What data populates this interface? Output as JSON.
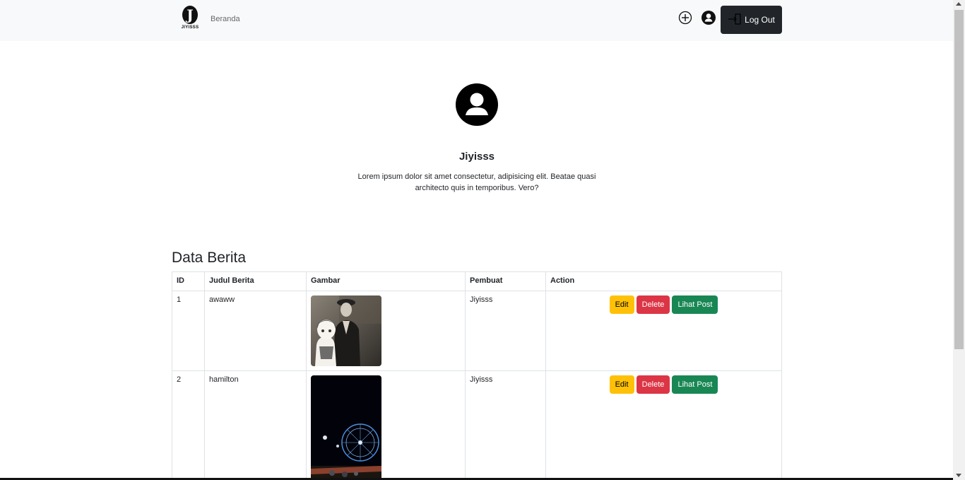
{
  "navbar": {
    "brand_letter": "J",
    "brand_text": "JIYISSS",
    "home_link": "Beranda",
    "logout_label": "Log Out",
    "icons": [
      "plus-circle-icon",
      "user-circle-icon",
      "logout-icon"
    ]
  },
  "profile": {
    "name": "Jiyisss",
    "description": "Lorem ipsum dolor sit amet consectetur, adipisicing elit. Beatae quasi architecto quis in temporibus. Vero?"
  },
  "section": {
    "title": "Data Berita"
  },
  "table": {
    "headers": [
      "ID",
      "Judul Berita",
      "Gambar",
      "Pembuat",
      "Action"
    ],
    "rows": [
      {
        "id": "1",
        "judul": "awaww",
        "gambar": "photo-two-people-sepia",
        "pembuat": "Jiyisss"
      },
      {
        "id": "2",
        "judul": "hamilton",
        "gambar": "photo-ferris-wheel-night",
        "pembuat": "Jiyisss"
      }
    ],
    "actions": {
      "edit": "Edit",
      "delete": "Delete",
      "view": "Lihat Post"
    }
  },
  "colors": {
    "navbar_bg": "#f8f9fa",
    "dark": "#212529",
    "warning": "#ffc107",
    "danger": "#dc3545",
    "success": "#198754"
  }
}
